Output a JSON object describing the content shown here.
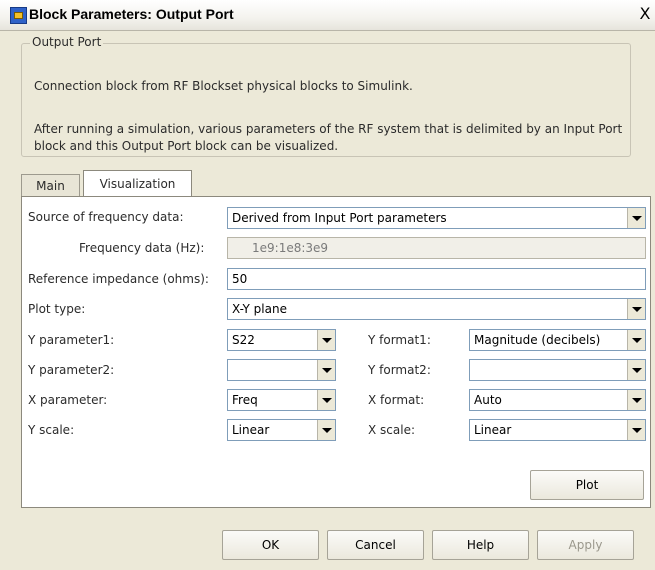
{
  "window": {
    "title": "Block Parameters: Output Port",
    "close": "X"
  },
  "group": {
    "legend": "Output Port",
    "line1": "Connection block from RF Blockset physical blocks to Simulink.",
    "line2": "After running a simulation, various parameters of the RF system that is delimited by an Input Port block and this Output Port block can be visualized."
  },
  "tabs": [
    {
      "label": "Main"
    },
    {
      "label": "Visualization"
    }
  ],
  "vis": {
    "source_label": "Source of frequency data:",
    "source_value": "Derived from Input Port parameters",
    "freq_label": "Frequency data (Hz):",
    "freq_value": "1e9:1e8:3e9",
    "impedance_label": "Reference impedance (ohms):",
    "impedance_value": "50",
    "plot_type_label": "Plot type:",
    "plot_type_value": "X-Y plane",
    "y_param1_label": "Y parameter1:",
    "y_param1_value": "S22",
    "y_format1_label": "Y format1:",
    "y_format1_value": "Magnitude (decibels)",
    "y_param2_label": "Y parameter2:",
    "y_param2_value": "",
    "y_format2_label": "Y format2:",
    "y_format2_value": "",
    "x_param_label": "X parameter:",
    "x_param_value": "Freq",
    "x_format_label": "X format:",
    "x_format_value": "Auto",
    "y_scale_label": "Y scale:",
    "y_scale_value": "Linear",
    "x_scale_label": "X scale:",
    "x_scale_value": "Linear",
    "plot_button": "Plot"
  },
  "buttons": {
    "ok": "OK",
    "cancel": "Cancel",
    "help": "Help",
    "apply": "Apply"
  }
}
